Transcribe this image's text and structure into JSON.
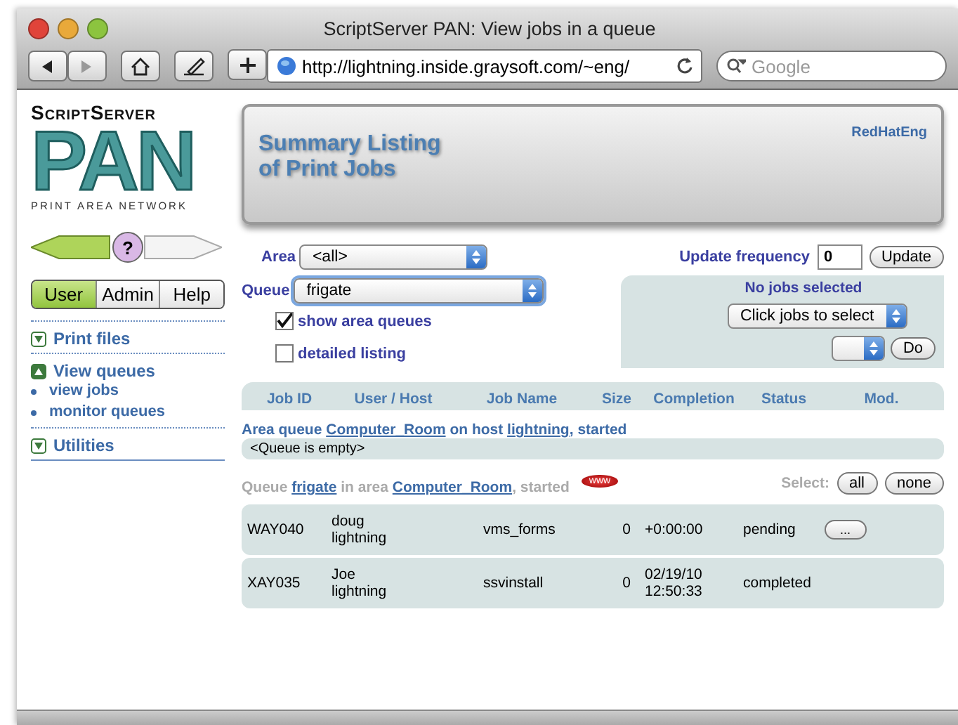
{
  "window": {
    "title": "ScriptServer PAN: View jobs in a queue"
  },
  "toolbar": {
    "url": "http://lightning.inside.graysoft.com/~eng/",
    "search_placeholder": "Google"
  },
  "logo": {
    "brand": "ScriptServer",
    "product": "PAN",
    "tagline": "PRINT AREA NETWORK",
    "help": "?"
  },
  "mode_tabs": [
    {
      "label": "User",
      "selected": true
    },
    {
      "label": "Admin",
      "selected": false
    },
    {
      "label": "Help",
      "selected": false
    }
  ],
  "sidebar": {
    "items": [
      {
        "label": "Print files",
        "expanded": false
      },
      {
        "label": "View queues",
        "expanded": true,
        "children": [
          {
            "label": "view jobs"
          },
          {
            "label": "monitor queues"
          }
        ]
      },
      {
        "label": "Utilities",
        "expanded": false
      }
    ]
  },
  "header": {
    "title_lines": [
      "Summary Listing",
      "of Print Jobs"
    ],
    "user": "RedHatEng"
  },
  "filters": {
    "area_label": "Area",
    "area_value": "<all>",
    "queue_label": "Queue",
    "queue_value": "frigate",
    "checkboxes": [
      {
        "label": "show area queues",
        "checked": true
      },
      {
        "label": "detailed listing",
        "checked": false
      }
    ]
  },
  "update": {
    "label": "Update frequency",
    "value": "0",
    "button": "Update"
  },
  "actions": {
    "status": "No jobs selected",
    "select_value": "Click jobs to select",
    "button": "Do"
  },
  "table": {
    "columns": [
      "Job ID",
      "User / Host",
      "Job Name",
      "Size",
      "Completion",
      "Status",
      "Mod."
    ]
  },
  "area_queue": {
    "parts": [
      {
        "text": "Area queue ",
        "link": false
      },
      {
        "text": "Computer_Room",
        "link": true
      },
      {
        "text": " on host ",
        "link": false
      },
      {
        "text": "lightning",
        "link": true
      },
      {
        "text": ", started",
        "link": false
      }
    ],
    "empty": "<Queue is empty>"
  },
  "queue": {
    "parts": [
      {
        "text": "Queue ",
        "link": false
      },
      {
        "text": "frigate",
        "link": true
      },
      {
        "text": " in area ",
        "link": false
      },
      {
        "text": "Computer_Room",
        "link": true
      },
      {
        "text": ", started",
        "link": false
      }
    ],
    "badge": "www",
    "select_label": "Select:",
    "buttons": [
      "all",
      "none"
    ]
  },
  "rows": [
    {
      "id": "WAY040",
      "user": "doug",
      "host": "lightning",
      "name": "vms_forms",
      "size": "0",
      "completion": [
        "+0:00:00"
      ],
      "status": "pending",
      "action": "..."
    },
    {
      "id": "XAY035",
      "user": "Joe",
      "host": "lightning",
      "name": "ssvinstall",
      "size": "0",
      "completion": [
        "02/19/10",
        "12:50:33"
      ],
      "status": "completed"
    }
  ]
}
